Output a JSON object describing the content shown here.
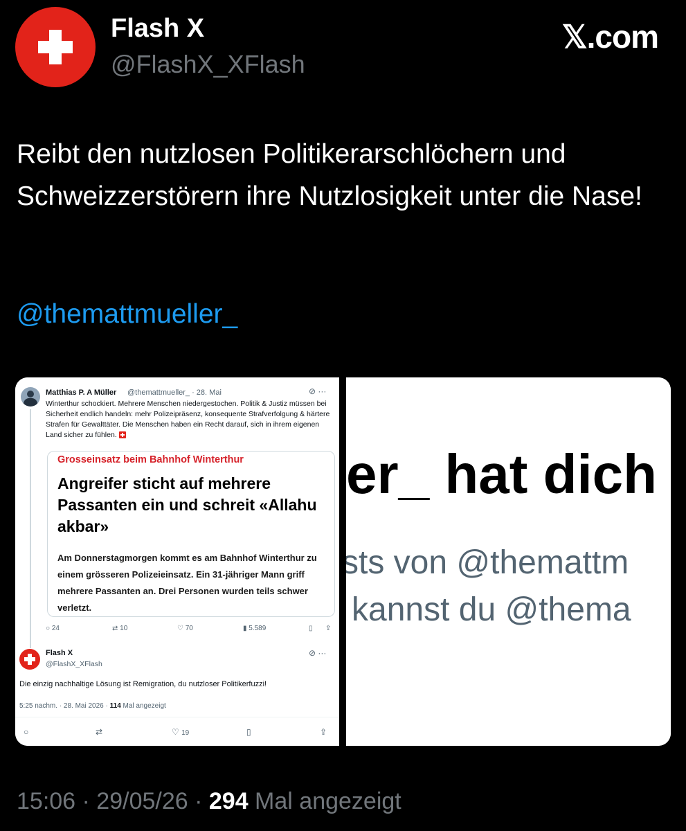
{
  "author": {
    "name": "Flash X",
    "handle": "@FlashX_XFlash",
    "avatar": "swiss-flag-icon",
    "brand_color": "#e2231a"
  },
  "source_label": "𝕏.com",
  "tweet": {
    "text": "Reibt den nutzlosen Politikerarschlöchern und Schweizzerstörern ihre Nutzlosigkeit unter die Nase!",
    "mention": "@themattmueller_",
    "mention_color": "#1d9bf0"
  },
  "footer": {
    "time_date": "15:06 · 29/05/26 · ",
    "views": "294",
    "views_label": " Mal angezeigt"
  },
  "embedded": {
    "original": {
      "name": "Matthias P. A Müller",
      "handle_date": "@themattmueller_ · 28. Mai",
      "text": "Winterthur schockiert. Mehrere Menschen niedergestochen. Politik & Justiz müssen bei Sicherheit endlich handeln: mehr Polizeipräsenz, konsequente Strafverfolgung & härtere Strafen für Gewalttäter. Die Menschen haben ein Recht darauf, sich in ihrem eigenen Land sicher zu fühlen.",
      "card": {
        "kicker": "Grosseinsatz beim Bahnhof Winterthur",
        "title": "Angreifer sticht auf mehrere Passanten ein und schreit «Allahu akbar»",
        "lead": "Am Donnerstagmorgen kommt es am Bahnhof Winterthur zu einem grösseren Polizeieinsatz. Ein 31-jähriger Mann griff mehrere Passanten an. Drei Personen wurden teils schwer verletzt."
      },
      "replies": "24",
      "reposts": "10",
      "likes": "70",
      "views": "5.589"
    },
    "reply": {
      "name": "Flash X",
      "handle": "@FlashX_XFlash",
      "text": "Die einzig nachhaltige Lösung ist Remigration, du nutzloser Politikerfuzzi!",
      "meta_time": "5:25 nachm. · 28. Mai 2026 · ",
      "meta_views": "114",
      "meta_views_label": " Mal angezeigt",
      "likes": "19"
    }
  },
  "zoomed": {
    "line1": "er_ hat dich",
    "line2": "sts von @themattm",
    "line3": "kannst du @thema"
  }
}
